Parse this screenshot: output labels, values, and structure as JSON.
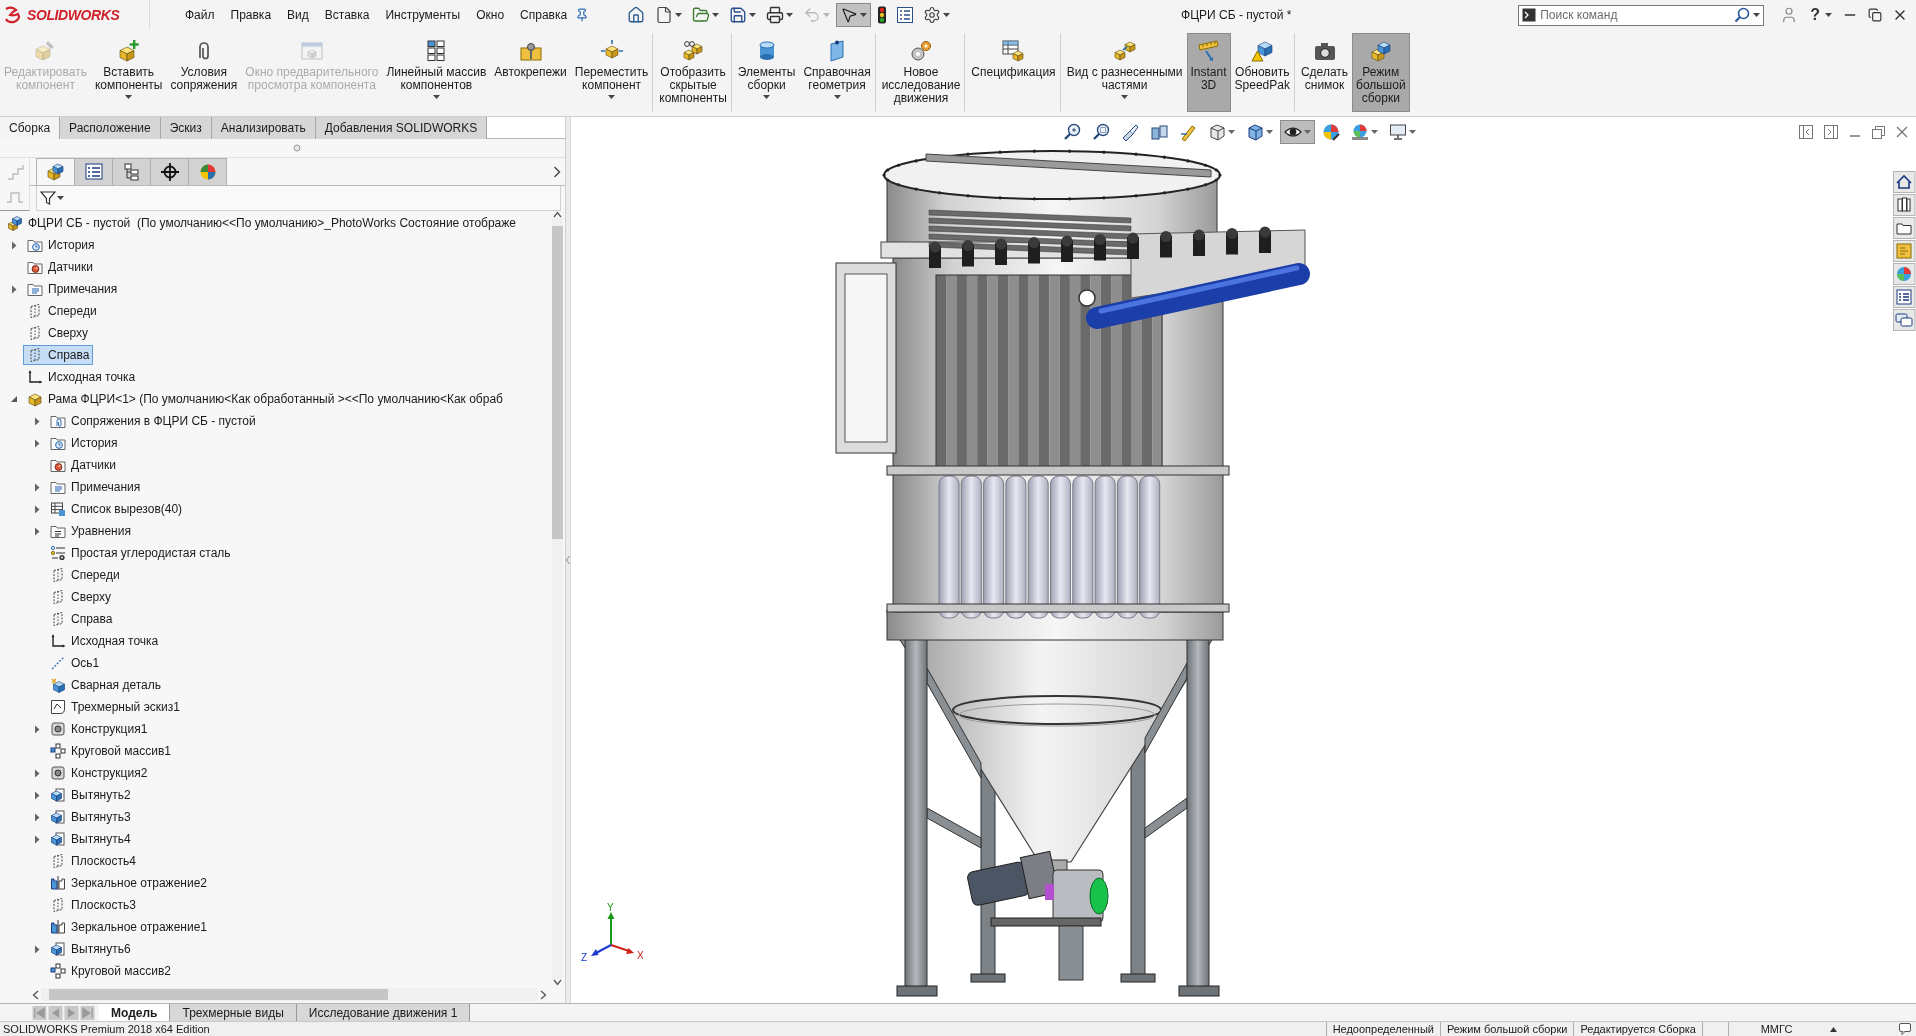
{
  "window": {
    "logo": "SOLIDWORKS",
    "title": "ФЦРИ СБ - пустой *",
    "help": "?"
  },
  "menu": [
    "Файл",
    "Правка",
    "Вид",
    "Вставка",
    "Инструменты",
    "Окно",
    "Справка"
  ],
  "quick_access": [
    {
      "dropdown": false,
      "pressed": false,
      "disabled": false
    },
    {
      "dropdown": true,
      "pressed": false,
      "disabled": false
    },
    {
      "dropdown": true,
      "pressed": false,
      "disabled": false
    },
    {
      "dropdown": true,
      "pressed": false,
      "disabled": false
    },
    {
      "dropdown": true,
      "pressed": false,
      "disabled": false
    },
    {
      "dropdown": true,
      "pressed": false,
      "disabled": true
    },
    {
      "dropdown": true,
      "pressed": true,
      "disabled": false
    },
    {
      "dropdown": false,
      "pressed": false,
      "disabled": false
    },
    {
      "dropdown": false,
      "pressed": false,
      "disabled": false
    },
    {
      "dropdown": true,
      "pressed": false,
      "disabled": false
    }
  ],
  "search": {
    "placeholder": "Поиск команд"
  },
  "ribbon": [
    {
      "label": "Редактировать\nкомпонент",
      "disabled": true,
      "pressed": false,
      "dropdown": false,
      "separator_before": false
    },
    {
      "label": "Вставить\nкомпоненты",
      "disabled": false,
      "pressed": false,
      "dropdown": true,
      "separator_before": false
    },
    {
      "label": "Условия\nсопряжения",
      "disabled": false,
      "pressed": false,
      "dropdown": false,
      "separator_before": false
    },
    {
      "label": "Окно предварительного\nпросмотра компонента",
      "disabled": true,
      "pressed": false,
      "dropdown": false,
      "separator_before": false
    },
    {
      "label": "Линейный массив\nкомпонентов",
      "disabled": false,
      "pressed": false,
      "dropdown": true,
      "separator_before": false
    },
    {
      "label": "Автокрепежи",
      "disabled": false,
      "pressed": false,
      "dropdown": false,
      "separator_before": false
    },
    {
      "label": "Переместить\nкомпонент",
      "disabled": false,
      "pressed": false,
      "dropdown": true,
      "separator_before": false
    },
    {
      "label": "Отобразить\nскрытые\nкомпоненты",
      "disabled": false,
      "pressed": false,
      "dropdown": false,
      "separator_before": true
    },
    {
      "label": "Элементы\nсборки",
      "disabled": false,
      "pressed": false,
      "dropdown": true,
      "separator_before": true
    },
    {
      "label": "Справочная\nгеометрия",
      "disabled": false,
      "pressed": false,
      "dropdown": true,
      "separator_before": false
    },
    {
      "label": "Новое\nисследование\nдвижения",
      "disabled": false,
      "pressed": false,
      "dropdown": false,
      "separator_before": true
    },
    {
      "label": "Спецификация",
      "disabled": false,
      "pressed": false,
      "dropdown": false,
      "separator_before": true
    },
    {
      "label": "Вид с разнесенными\nчастями",
      "disabled": false,
      "pressed": false,
      "dropdown": true,
      "separator_before": true
    },
    {
      "label": "Instant\n3D",
      "disabled": false,
      "pressed": true,
      "dropdown": false,
      "separator_before": false
    },
    {
      "label": "Обновить\nSpeedPak",
      "disabled": false,
      "pressed": false,
      "dropdown": false,
      "separator_before": false
    },
    {
      "label": "Сделать\nснимок",
      "disabled": false,
      "pressed": false,
      "dropdown": false,
      "separator_before": true
    },
    {
      "label": "Режим\nбольшой\nсборки",
      "disabled": false,
      "pressed": true,
      "dropdown": false,
      "separator_before": false
    }
  ],
  "ribbon_tabs": [
    {
      "label": "Сборка",
      "selected": true
    },
    {
      "label": "Расположение",
      "selected": false
    },
    {
      "label": "Эскиз",
      "selected": false
    },
    {
      "label": "Анализировать",
      "selected": false
    },
    {
      "label": "Добавления SOLIDWORKS",
      "selected": false
    }
  ],
  "panel_tabs": [
    {
      "selected": true
    },
    {
      "selected": false
    },
    {
      "selected": false
    },
    {
      "selected": false
    },
    {
      "selected": false
    }
  ],
  "feature_tree": {
    "items": [
      {
        "label": "ФЦРИ СБ - пустой  (По умолчанию<<По умолчанию>_PhotoWorks Состояние отображе",
        "kind": "assembly",
        "selected": false,
        "children": [
          {
            "label": "История",
            "kind": "history",
            "expanded": false,
            "selected": false
          },
          {
            "label": "Датчики",
            "kind": "sensors",
            "selected": false
          },
          {
            "label": "Примечания",
            "kind": "annotations",
            "expanded": false,
            "selected": false
          },
          {
            "label": "Спереди",
            "kind": "plane",
            "selected": false
          },
          {
            "label": "Сверху",
            "kind": "plane",
            "selected": false
          },
          {
            "label": "Справа",
            "kind": "plane",
            "selected": true
          },
          {
            "label": "Исходная точка",
            "kind": "origin",
            "selected": false
          },
          {
            "label": "Рама ФЦРИ<1> (По умолчанию<Как обработанный ><<По умолчанию<Как обраб",
            "kind": "part",
            "expanded": true,
            "selected": false,
            "children": [
              {
                "label": "Сопряжения в ФЦРИ СБ - пустой",
                "kind": "mates",
                "expanded": false,
                "selected": false
              },
              {
                "label": "История",
                "kind": "history",
                "expanded": false,
                "selected": false
              },
              {
                "label": "Датчики",
                "kind": "sensors",
                "selected": false
              },
              {
                "label": "Примечания",
                "kind": "annotations",
                "expanded": false,
                "selected": false
              },
              {
                "label": "Список вырезов(40)",
                "kind": "cutlist",
                "expanded": false,
                "selected": false
              },
              {
                "label": "Уравнения",
                "kind": "equations",
                "expanded": false,
                "selected": false
              },
              {
                "label": "Простая углеродистая сталь",
                "kind": "material",
                "selected": false
              },
              {
                "label": "Спереди",
                "kind": "plane",
                "selected": false
              },
              {
                "label": "Сверху",
                "kind": "plane",
                "selected": false
              },
              {
                "label": "Справа",
                "kind": "plane",
                "selected": false
              },
              {
                "label": "Исходная точка",
                "kind": "origin",
                "selected": false
              },
              {
                "label": "Ось1",
                "kind": "axis",
                "selected": false
              },
              {
                "label": "Сварная деталь",
                "kind": "weldment",
                "selected": false
              },
              {
                "label": "Трехмерный эскиз1",
                "kind": "sketch",
                "selected": false
              },
              {
                "label": "Конструкция1",
                "kind": "structure",
                "expanded": false,
                "selected": false
              },
              {
                "label": "Круговой массив1",
                "kind": "pattern",
                "selected": false
              },
              {
                "label": "Конструкция2",
                "kind": "structure",
                "expanded": false,
                "selected": false
              },
              {
                "label": "Вытянуть2",
                "kind": "extrude",
                "expanded": false,
                "selected": false
              },
              {
                "label": "Вытянуть3",
                "kind": "extrude",
                "expanded": false,
                "selected": false
              },
              {
                "label": "Вытянуть4",
                "kind": "extrude",
                "expanded": false,
                "selected": false
              },
              {
                "label": "Плоскость4",
                "kind": "plane",
                "selected": false
              },
              {
                "label": "Зеркальное отражение2",
                "kind": "mirror",
                "selected": false
              },
              {
                "label": "Плоскость3",
                "kind": "plane",
                "selected": false
              },
              {
                "label": "Зеркальное отражение1",
                "kind": "mirror",
                "selected": false
              },
              {
                "label": "Вытянуть6",
                "kind": "extrude",
                "expanded": false,
                "selected": false
              },
              {
                "label": "Круговой массив2",
                "kind": "pattern",
                "selected": false
              }
            ]
          }
        ]
      }
    ]
  },
  "viewport": {
    "view_toolbar": [
      {
        "dropdown": false,
        "pressed": false
      },
      {
        "dropdown": false,
        "pressed": false
      },
      {
        "dropdown": false,
        "pressed": false
      },
      {
        "dropdown": false,
        "pressed": false
      },
      {
        "dropdown": false,
        "pressed": false
      },
      {
        "dropdown": true,
        "pressed": false
      },
      {
        "dropdown": true,
        "pressed": false
      },
      {
        "dropdown": true,
        "pressed": true
      },
      {
        "dropdown": false,
        "pressed": false
      },
      {
        "dropdown": true,
        "pressed": false
      },
      {
        "dropdown": true,
        "pressed": false
      }
    ],
    "triad": {
      "x": "X",
      "y": "Y",
      "z": "Z"
    }
  },
  "sheet_nav": [
    {
      "disabled": true
    },
    {
      "disabled": true
    },
    {
      "disabled": true
    },
    {
      "disabled": true
    }
  ],
  "sheet_tabs": [
    {
      "label": "Модель",
      "selected": true
    },
    {
      "label": "Трехмерные виды",
      "selected": false
    },
    {
      "label": "Исследование движения 1",
      "selected": false
    }
  ],
  "status_bar": {
    "product": "SOLIDWORKS Premium 2018 x64 Edition",
    "cells": [
      "Недоопределенный",
      "Режим большой сборки",
      "Редактируется Сборка"
    ],
    "units": "ММГС"
  }
}
